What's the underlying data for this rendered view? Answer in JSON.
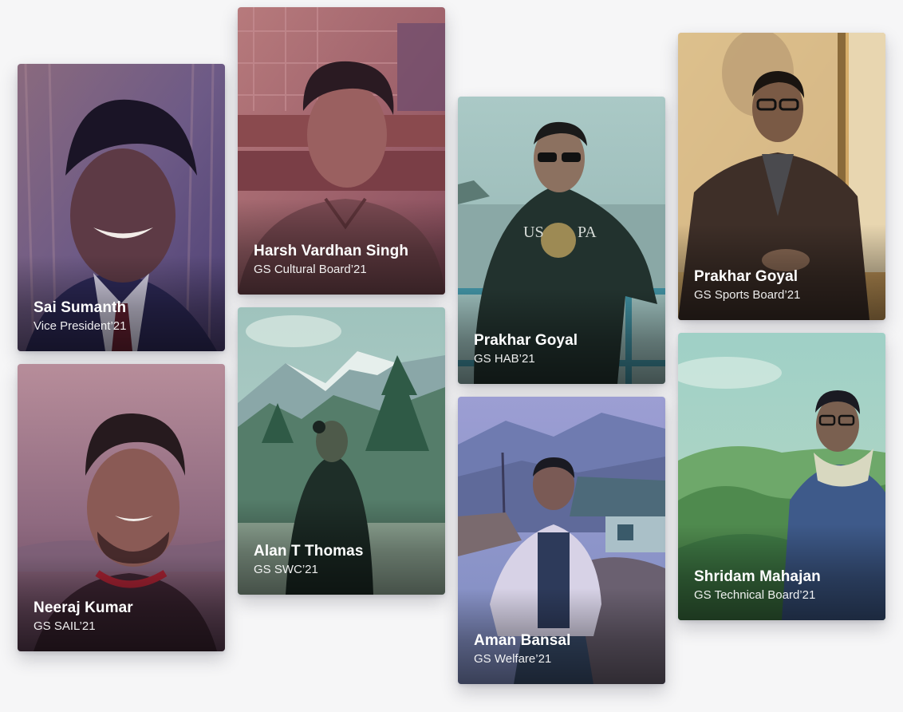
{
  "members": [
    {
      "id": "sai",
      "name": "Sai Sumanth",
      "role": "Vice President’21"
    },
    {
      "id": "neeraj",
      "name": "Neeraj Kumar",
      "role": "GS SAIL’21"
    },
    {
      "id": "harsh",
      "name": "Harsh Vardhan Singh",
      "role": "GS Cultural Board’21"
    },
    {
      "id": "alan",
      "name": "Alan T Thomas",
      "role": "GS SWC’21"
    },
    {
      "id": "prakhar_hab",
      "name": "Prakhar Goyal",
      "role": "GS HAB’21"
    },
    {
      "id": "aman",
      "name": "Aman Bansal",
      "role": "GS Welfare’21"
    },
    {
      "id": "prakhar_sports",
      "name": "Prakhar Goyal",
      "role": "GS Sports Board’21"
    },
    {
      "id": "shridam",
      "name": "Shridam Mahajan",
      "role": "GS Technical Board’21"
    }
  ],
  "colors": {
    "background": "#f6f6f7",
    "caption_text": "#ffffff",
    "tint_purple": "#5a4a8c",
    "tint_rose": "#a0607a",
    "tint_teal": "#6a9a90",
    "tint_gold": "#c89a50",
    "tint_green": "#4f8a55"
  }
}
